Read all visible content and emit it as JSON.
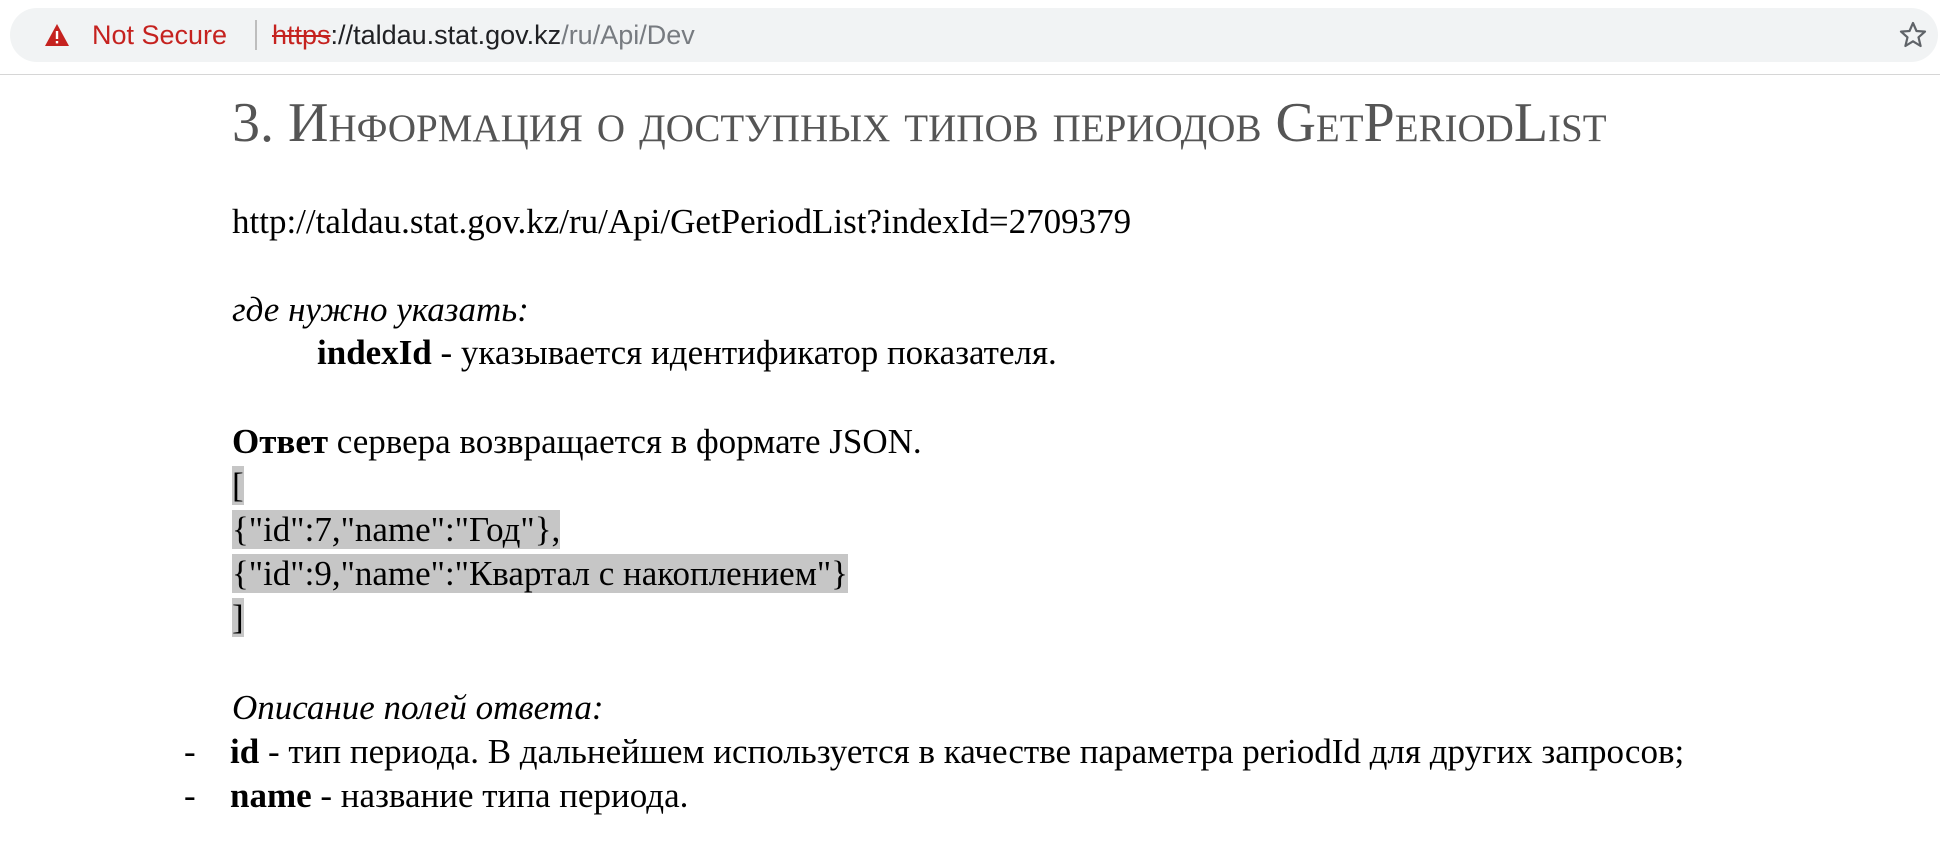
{
  "browser": {
    "security_label": "Not Secure",
    "url": {
      "scheme": "https",
      "after_scheme": "://",
      "host": "taldau.stat.gov.kz",
      "path": "/ru/Api/Dev"
    },
    "icons": {
      "warning": "warning-triangle-icon",
      "bookmark": "star-icon"
    },
    "colors": {
      "insecure": "#c5221f",
      "path": "#777b80"
    }
  },
  "page": {
    "heading": "3. Информация о доступных типов периодов GetPeriodList",
    "request_url": "http://taldau.stat.gov.kz/ru/Api/GetPeriodList?indexId=2709379",
    "params_intro": "где нужно указать:",
    "param": {
      "name": "indexId",
      "description": " - указывается идентификатор показателя."
    },
    "response": {
      "bold": "Ответ",
      "rest": " сервера возвращается в формате JSON."
    },
    "json_lines": [
      "[",
      "{\"id\":7,\"name\":\"Год\"},",
      "{\"id\":9,\"name\":\"Квартал с накоплением\"}",
      "]"
    ],
    "fields_intro": "Описание полей ответа:",
    "fields": [
      {
        "dash": "-",
        "name": "id",
        "description": " - тип периода. В дальнейшем используется в качестве параметра periodId для других запросов;"
      },
      {
        "dash": "-",
        "name": "name",
        "description": " - название типа периода."
      }
    ],
    "highlight_color": "#c6c6c6"
  }
}
